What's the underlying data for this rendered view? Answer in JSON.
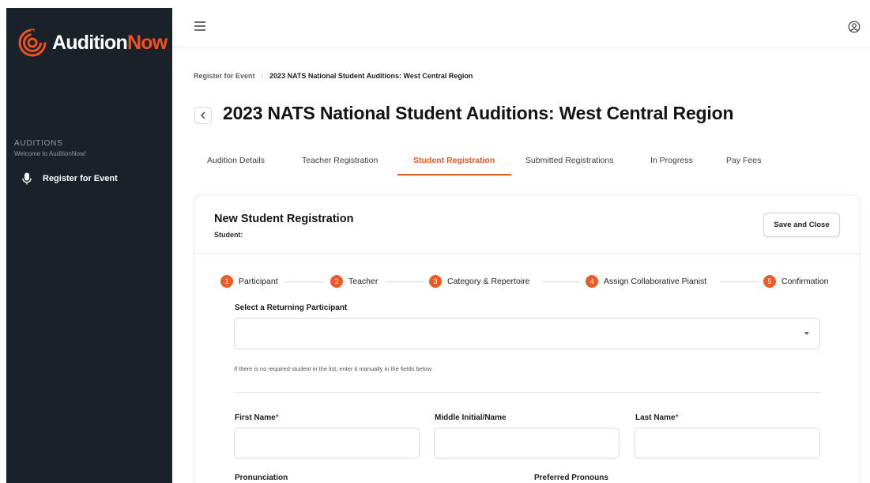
{
  "brand": {
    "name_primary": "Audition",
    "name_accent": "Now",
    "accent_color": "#f0521f"
  },
  "sidebar": {
    "section_heading": "AUDITIONS",
    "section_subtitle": "Welcome to AuditionNow!",
    "items": [
      {
        "label": "Register for Event",
        "icon": "microphone-icon"
      }
    ]
  },
  "topbar": {
    "menu_icon": "hamburger-icon",
    "user_icon": "user-profile-icon"
  },
  "breadcrumb": {
    "items": [
      "Register for Event",
      "2023 NATS National Student Auditions: West Central Region"
    ],
    "separator": "/"
  },
  "page": {
    "title": "2023 NATS National Student Auditions: West Central Region"
  },
  "tabs": [
    {
      "label": "Audition Details",
      "active": false
    },
    {
      "label": "Teacher Registration",
      "active": false
    },
    {
      "label": "Student Registration",
      "active": true
    },
    {
      "label": "Submitted Registrations",
      "active": false
    },
    {
      "label": "In Progress",
      "active": false
    },
    {
      "label": "Pay Fees",
      "active": false
    }
  ],
  "form": {
    "title": "New Student Registration",
    "subtitle": "Student:",
    "save_button": "Save and Close",
    "steps": [
      {
        "number": "1",
        "label": "Participant"
      },
      {
        "number": "2",
        "label": "Teacher"
      },
      {
        "number": "3",
        "label": "Category & Repertoire"
      },
      {
        "number": "4",
        "label": "Assign Collaborative Pianist"
      },
      {
        "number": "5",
        "label": "Confirmation"
      }
    ],
    "returning_participant": {
      "label": "Select a Returning Participant",
      "value": ""
    },
    "hint": "If there is no required student in the list, enter it manually in the fields below",
    "fields": {
      "first_name": {
        "label": "First Name",
        "required_mark": "*",
        "value": ""
      },
      "middle_name": {
        "label": "Middle Initial/Name",
        "value": ""
      },
      "last_name": {
        "label": "Last Name",
        "required_mark": "*",
        "value": ""
      },
      "pronunciation": {
        "label": "Pronunciation"
      },
      "preferred_pronouns": {
        "label": "Preferred Pronouns"
      }
    }
  }
}
